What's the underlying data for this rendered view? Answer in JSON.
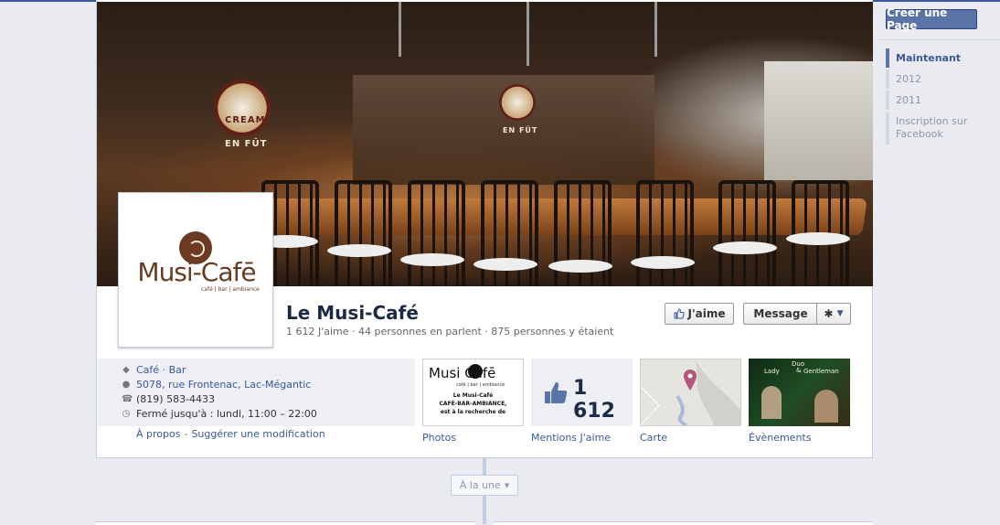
{
  "colors": {
    "brand": "#3b5998",
    "button": "#5b74a8",
    "logo": "#6b3a22"
  },
  "cover": {
    "sign_left": {
      "label_top": "CREAM",
      "label_bottom": "EN FÛT"
    },
    "sign_right": {
      "label_bottom": "EN FÛT"
    }
  },
  "logo": {
    "name": "Musi-Cafē",
    "sub": "café | bar | ambiance"
  },
  "page": {
    "name": "Le Musi-Café",
    "stats": "1 612 J'aime · 44 personnes en parlent · 875 personnes y étaient"
  },
  "actions": {
    "like": "J'aime",
    "message": "Message",
    "gear_icon": "gear-icon",
    "like_icon": "thumbs-up-icon"
  },
  "info": {
    "category_a": "Café",
    "category_sep": " · ",
    "category_b": "Bar",
    "address": "5078, rue Frontenac, Lac-Mégantic",
    "phone": "(819) 583-4433",
    "hours": "Fermé jusqu'à : lundi, 11:00 – 22:00",
    "about": "À propos",
    "suggest": "Suggérer une modification",
    "sep": "-"
  },
  "tiles": {
    "photos": {
      "label": "Photos",
      "logo": "Musi Cafē",
      "sub": "café | bar | ambiance",
      "line1": "Le Musi-Café",
      "line2": "CAFÉ-BAR-AMBIANCE,",
      "line3": "est à la recherche de"
    },
    "likes": {
      "label": "Mentions J'aime",
      "count": "1 612"
    },
    "map": {
      "label": "Carte"
    },
    "events": {
      "label": "Évènements",
      "duo": "Duo",
      "lady": "Lady",
      "amp": "&",
      "gentleman": "Gentleman"
    }
  },
  "timeline": {
    "button": "À la une"
  },
  "sidebar": {
    "create_page": "Créer une Page",
    "years": [
      "Maintenant",
      "2012",
      "2011",
      "Inscription sur Facebook"
    ]
  }
}
